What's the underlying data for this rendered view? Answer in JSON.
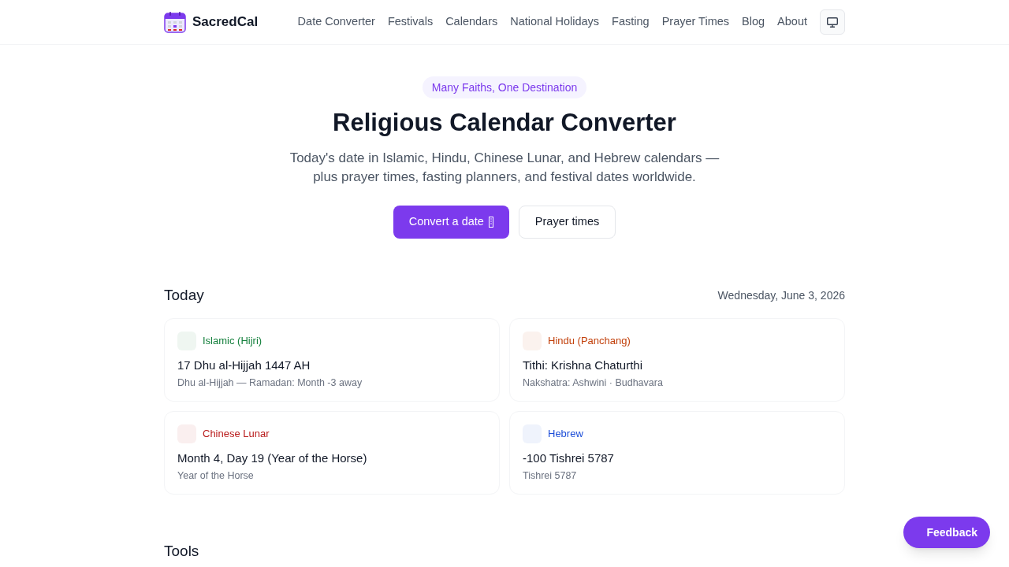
{
  "header": {
    "logo": "SacredCal",
    "nav": [
      {
        "label": "Date Converter"
      },
      {
        "label": "Festivals"
      },
      {
        "label": "Calendars"
      },
      {
        "label": "National Holidays"
      },
      {
        "label": "Fasting"
      },
      {
        "label": "Prayer Times"
      },
      {
        "label": "Blog"
      },
      {
        "label": "About"
      }
    ]
  },
  "hero": {
    "badge": "Many Faiths, One Destination",
    "title": "Religious Calendar Converter",
    "subtitle": "Today's date in Islamic, Hindu, Chinese Lunar, and Hebrew calendars — plus prayer times, fasting planners, and festival dates worldwide.",
    "buttons": [
      {
        "label": "Convert a date",
        "kind": "primary"
      },
      {
        "label": "Prayer times",
        "kind": "secondary"
      }
    ]
  },
  "today": {
    "heading": "Today",
    "date": "Wednesday, June 3, 2026",
    "cards": [
      {
        "calendar": "Islamic (Hijri)",
        "color": "#15803d",
        "date": "17 Dhu al-Hijjah 1447 AH",
        "detail": "Dhu al-Hijjah — Ramadan: Month -3 away"
      },
      {
        "calendar": "Hindu (Panchang)",
        "color": "#c2410c",
        "date": "Tithi: Krishna Chaturthi",
        "detail": "Nakshatra: Ashwini · Budhavara"
      },
      {
        "calendar": "Chinese Lunar",
        "color": "#b91c1c",
        "date": "Month 4, Day 19 (Year of the Horse)",
        "detail": "Year of the Horse"
      },
      {
        "calendar": "Hebrew",
        "color": "#1d4ed8",
        "date": "-100 Tishrei 5787",
        "detail": "Tishrei 5787"
      }
    ]
  },
  "tools": {
    "heading": "Tools"
  },
  "feedback_button": {
    "label": "Feedback"
  }
}
